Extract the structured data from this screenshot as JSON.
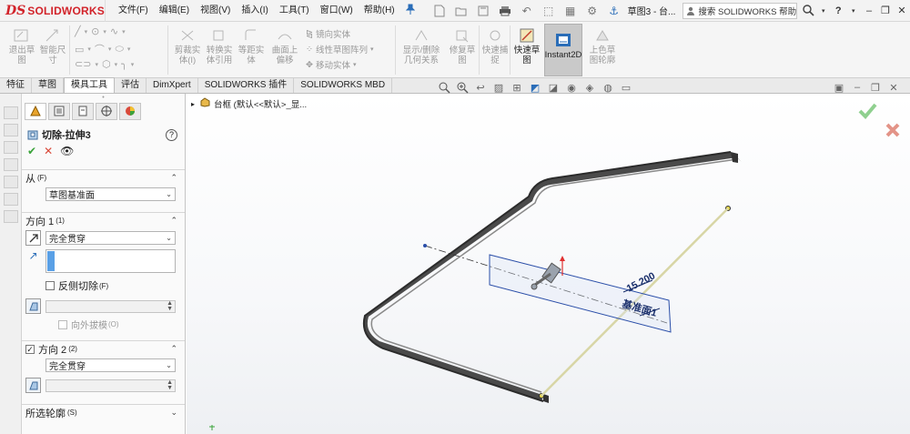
{
  "app": {
    "logo_mark": "DS",
    "logo_text": "SOLIDWORKS"
  },
  "menu": [
    "文件(F)",
    "编辑(E)",
    "视图(V)",
    "插入(I)",
    "工具(T)",
    "窗口(W)",
    "帮助(H)"
  ],
  "titlebar": {
    "doc_title": "草图3 - 台...",
    "search_label": "搜索 SOLIDWORKS 帮助",
    "help": "?"
  },
  "ribbon": {
    "exit_sketch": "退出草\n图",
    "smart_dim": "智能尺\n寸",
    "trim": "剪裁实\n体(I)",
    "convert": "转换实\n体引用",
    "offset": "等距实\n体",
    "offset_surface": "曲面上\n偏移",
    "mirror": "镜向实体",
    "linear_pattern": "线性草图阵列",
    "move": "移动实体",
    "display_relations": "显示/删除\n几何关系",
    "repair": "修复草\n图",
    "quick_snaps": "快速捕\n捉",
    "rapid_sketch": "快速草\n图",
    "instant2d": "Instant2D",
    "shaded_contours": "上色草\n图轮廓"
  },
  "tabs": [
    {
      "label": "特征",
      "active": false
    },
    {
      "label": "草图",
      "active": false
    },
    {
      "label": "模具工具",
      "active": true
    },
    {
      "label": "评估",
      "active": false
    },
    {
      "label": "DimXpert",
      "active": false
    },
    {
      "label": "SOLIDWORKS 插件",
      "active": false
    },
    {
      "label": "SOLIDWORKS MBD",
      "active": false
    }
  ],
  "tree": {
    "text": "台框  (默认<<默认>_显..."
  },
  "panel": {
    "feature_title": "切除-拉伸3",
    "help": "?",
    "from": {
      "label": "从",
      "sup": "(F)",
      "value": "草图基准面"
    },
    "dir1": {
      "label": "方向 1",
      "sup": "(1)",
      "type": "完全贯穿",
      "reverse": "反侧切除",
      "reverse_sup": "(F)",
      "draft": "向外拔模",
      "draft_sup": "(O)"
    },
    "dir2": {
      "label": "方向 2",
      "sup": "(2)",
      "type": "完全贯穿"
    },
    "contours": {
      "label": "所选轮廓",
      "sup": "(S)"
    }
  },
  "graphics": {
    "dimension": "15.200",
    "plane_label": "基准面1"
  },
  "colors": {
    "brand": "#d2232a",
    "ok_green": "#3aa33a",
    "cancel_red": "#d94a3a",
    "plane_blue": "#2a4ea8",
    "accent_blue": "#2a6db8"
  }
}
